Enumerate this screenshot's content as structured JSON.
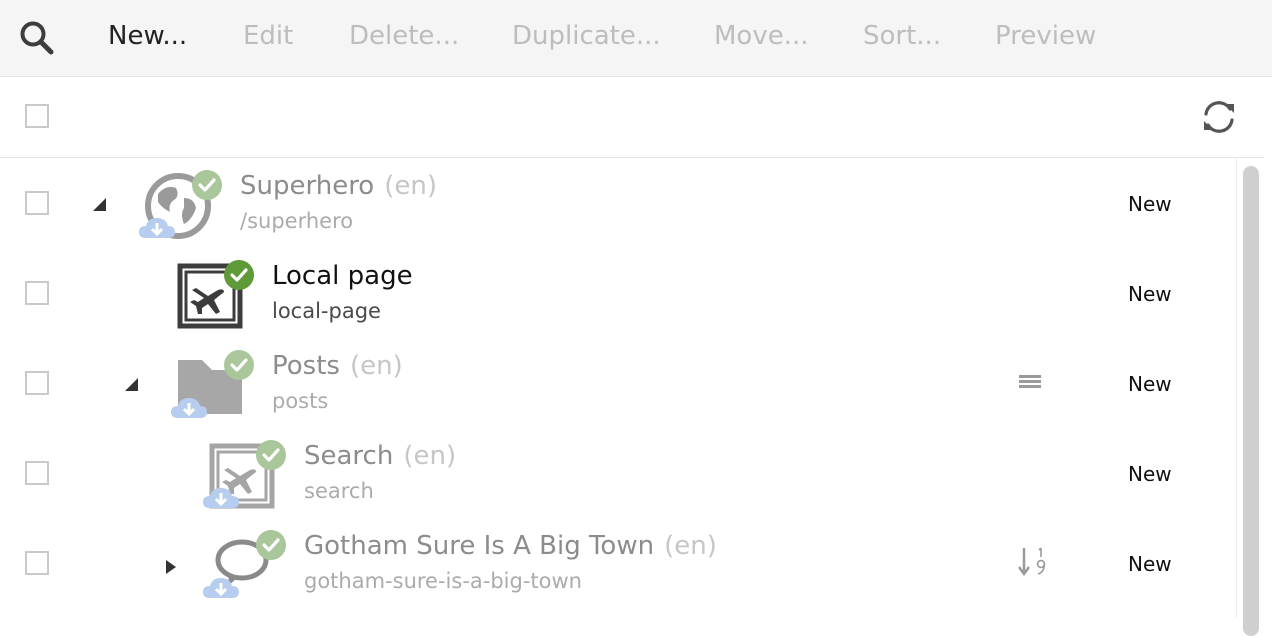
{
  "toolbar": {
    "search_icon": "magnifier-icon",
    "new_label": "New...",
    "edit_label": "Edit",
    "delete_label": "Delete...",
    "duplicate_label": "Duplicate...",
    "move_label": "Move...",
    "sort_label": "Sort...",
    "preview_label": "Preview"
  },
  "header": {
    "refresh_icon": "refresh-icon"
  },
  "tree": [
    {
      "title": "Superhero",
      "lang": "(en)",
      "path": "/superhero",
      "status": "New",
      "icon": "globe-icon",
      "expanded": true
    },
    {
      "title": "Local page",
      "lang": "",
      "path": "local-page",
      "status": "New",
      "icon": "page-plane-icon"
    },
    {
      "title": "Posts",
      "lang": "(en)",
      "path": "posts",
      "status": "New",
      "icon": "folder-icon",
      "expanded": true,
      "extra_icon": "list-icon"
    },
    {
      "title": "Search",
      "lang": "(en)",
      "path": "search",
      "status": "New",
      "icon": "page-plane-icon"
    },
    {
      "title": "Gotham Sure Is A Big Town",
      "lang": "(en)",
      "path": "gotham-sure-is-a-big-town",
      "status": "New",
      "icon": "speech-bubble-icon",
      "expanded": false,
      "extra_icon": "sort-numeric-icon"
    }
  ],
  "colors": {
    "check_light": "#a9c79a",
    "check_dark": "#5f9a38",
    "cloud": "#b7cdef",
    "icon_gray": "#9a9a9a",
    "icon_dark": "#3c3c3c"
  }
}
